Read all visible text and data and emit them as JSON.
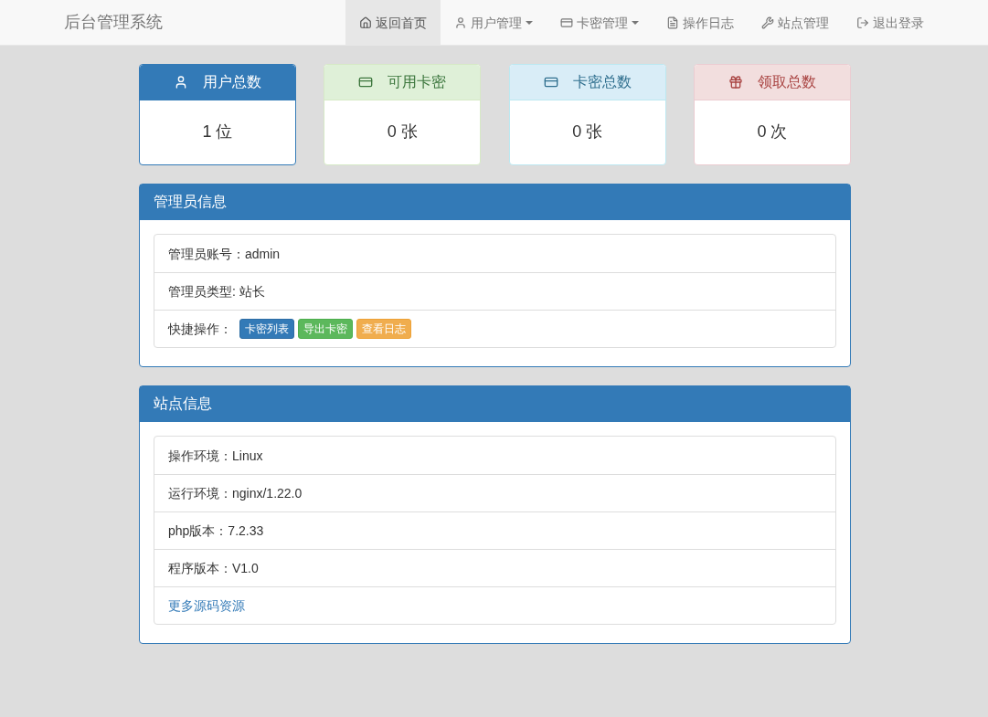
{
  "brand": "后台管理系统",
  "nav": [
    {
      "label": "返回首页",
      "kind": "link",
      "selected": true
    },
    {
      "label": "用户管理",
      "kind": "dropdown",
      "selected": false
    },
    {
      "label": "卡密管理",
      "kind": "dropdown",
      "selected": false
    },
    {
      "label": "操作日志",
      "kind": "link",
      "selected": false
    },
    {
      "label": "站点管理",
      "kind": "link",
      "selected": false
    },
    {
      "label": "退出登录",
      "kind": "link",
      "selected": false
    }
  ],
  "stats": [
    {
      "title": "用户总数",
      "value": "1 位",
      "kind": "primary"
    },
    {
      "title": "可用卡密",
      "value": "0 张",
      "kind": "success"
    },
    {
      "title": "卡密总数",
      "value": "0 张",
      "kind": "info"
    },
    {
      "title": "领取总数",
      "value": "0 次",
      "kind": "danger"
    }
  ],
  "panels": [
    {
      "title": "管理员信息",
      "rows": [
        {
          "kind": "text",
          "text": "管理员账号：admin"
        },
        {
          "kind": "text",
          "text": "管理员类型: 站长"
        },
        {
          "kind": "buttons",
          "text": "快捷操作：",
          "buttons": [
            {
              "label": "卡密列表",
              "kind": "primary"
            },
            {
              "label": "导出卡密",
              "kind": "success"
            },
            {
              "label": "查看日志",
              "kind": "warning"
            }
          ]
        }
      ]
    },
    {
      "title": "站点信息",
      "rows": [
        {
          "kind": "text",
          "text": "操作环境：Linux"
        },
        {
          "kind": "text",
          "text": "运行环境：nginx/1.22.0"
        },
        {
          "kind": "text",
          "text": "php版本：7.2.33"
        },
        {
          "kind": "text",
          "text": "程序版本：V1.0"
        },
        {
          "kind": "link",
          "text": "更多源码资源"
        }
      ]
    }
  ]
}
